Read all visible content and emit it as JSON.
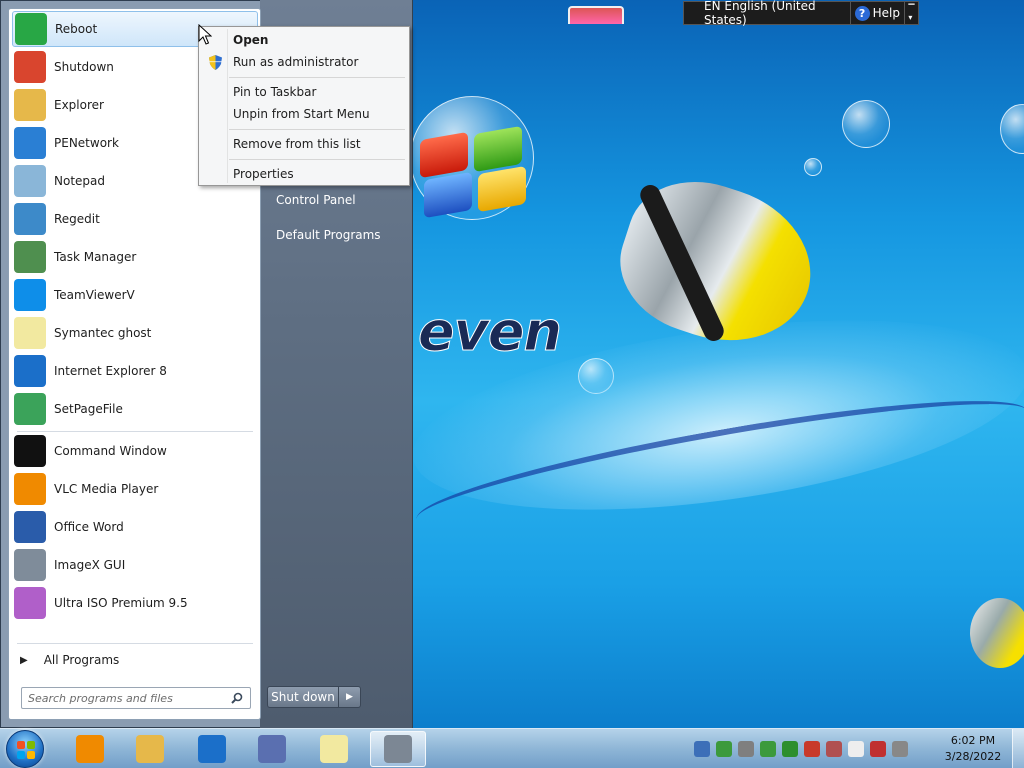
{
  "language_bar": {
    "language": "EN English (United States)",
    "help": "Help"
  },
  "start_menu": {
    "programs": [
      {
        "label": "Reboot",
        "icon": "reboot-icon",
        "color": "#28a745"
      },
      {
        "label": "Shutdown",
        "icon": "power-icon",
        "color": "#d9452e"
      },
      {
        "label": "Explorer",
        "icon": "folder-icon",
        "color": "#e6b84a"
      },
      {
        "label": "PENetwork",
        "icon": "network-icon",
        "color": "#2a7fd4"
      },
      {
        "label": "Notepad",
        "icon": "notepad-icon",
        "color": "#8ab6d8"
      },
      {
        "label": "Regedit",
        "icon": "registry-icon",
        "color": "#3d8ac9"
      },
      {
        "label": "Task Manager",
        "icon": "task-manager-icon",
        "color": "#4f8f4f"
      },
      {
        "label": "TeamViewerV",
        "icon": "teamviewer-icon",
        "color": "#0e8ee9"
      },
      {
        "label": "Symantec ghost",
        "icon": "ghost-icon",
        "color": "#f2e9a0"
      },
      {
        "label": "Internet Explorer 8",
        "icon": "internet-explorer-icon",
        "color": "#1b6fc9"
      },
      {
        "label": "SetPageFile",
        "icon": "pagefile-icon",
        "color": "#3ba35a"
      }
    ],
    "pinned_bottom": [
      {
        "label": "Command Window",
        "icon": "command-prompt-icon",
        "color": "#111111"
      },
      {
        "label": "VLC Media Player",
        "icon": "vlc-icon",
        "color": "#f08a00"
      },
      {
        "label": "Office Word",
        "icon": "word-icon",
        "color": "#2a5caa"
      },
      {
        "label": "ImageX GUI",
        "icon": "imagex-icon",
        "color": "#7f8c9a"
      },
      {
        "label": "Ultra ISO Premium 9.5",
        "icon": "ultraiso-icon",
        "color": "#b05fc9"
      }
    ],
    "all_programs": "All Programs",
    "search_placeholder": "Search programs and files",
    "right_items": [
      {
        "label": "Control Panel"
      },
      {
        "label": "Default Programs"
      }
    ],
    "shutdown_label": "Shut down"
  },
  "context_menu": {
    "items": [
      {
        "label": "Open",
        "bold": true
      },
      {
        "label": "Run as administrator",
        "shield": true
      },
      {
        "label": "Pin to Taskbar"
      },
      {
        "label": "Unpin from Start Menu"
      },
      {
        "label": "Remove from this list"
      },
      {
        "label": "Properties"
      }
    ]
  },
  "wallpaper": {
    "text": "even"
  },
  "taskbar": {
    "pinned": [
      {
        "icon": "media-player-icon",
        "color": "#f08a00"
      },
      {
        "icon": "explorer-folder-icon",
        "color": "#e6b84a"
      },
      {
        "icon": "internet-explorer-icon",
        "color": "#1b6fc9"
      },
      {
        "icon": "utility-icon",
        "color": "#5a6fb0"
      },
      {
        "icon": "ghost-icon",
        "color": "#f2e9a0"
      },
      {
        "icon": "active-app-icon",
        "color": "#7c8794"
      }
    ],
    "tray_icons": [
      {
        "icon": "language-tray-icon",
        "color": "#3c6fb8"
      },
      {
        "icon": "network-tray-icon",
        "color": "#3c9a3c"
      },
      {
        "icon": "drive-tray-icon",
        "color": "#7f7f7f"
      },
      {
        "icon": "check-tray-icon",
        "color": "#3c9a3c"
      },
      {
        "icon": "play-tray-icon",
        "color": "#2d8f2d"
      },
      {
        "icon": "shield-tray-icon",
        "color": "#c83a2a"
      },
      {
        "icon": "tools-tray-icon",
        "color": "#b05050"
      },
      {
        "icon": "flag-tray-icon",
        "color": "#eeeeee"
      },
      {
        "icon": "monitor-tray-icon",
        "color": "#c03030"
      },
      {
        "icon": "volume-tray-icon",
        "color": "#888888"
      }
    ],
    "time": "6:02 PM",
    "date": "3/28/2022"
  }
}
